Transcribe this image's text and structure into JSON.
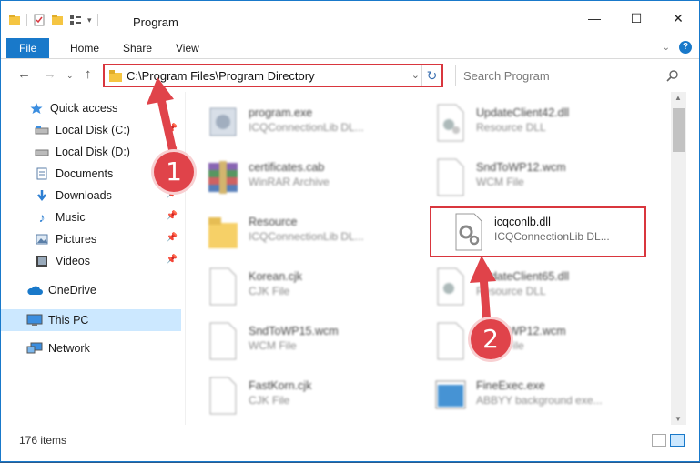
{
  "window": {
    "title": "Program",
    "controls": {
      "minimize": "—",
      "maximize": "☐",
      "close": "✕"
    }
  },
  "ribbon": {
    "tabs": [
      {
        "label": "File"
      },
      {
        "label": "Home"
      },
      {
        "label": "Share"
      },
      {
        "label": "View"
      }
    ],
    "help": "?"
  },
  "nav": {
    "address": "C:\\Program Files\\Program Directory",
    "search_placeholder": "Search Program"
  },
  "sidebar": {
    "items": [
      {
        "label": "Quick access",
        "icon": "star-icon"
      },
      {
        "label": "Local Disk (C:)",
        "icon": "drive-icon",
        "pinned": true
      },
      {
        "label": "Local Disk (D:)",
        "icon": "drive-icon",
        "pinned": true
      },
      {
        "label": "Documents",
        "icon": "document-icon",
        "pinned": true
      },
      {
        "label": "Downloads",
        "icon": "download-icon",
        "pinned": true
      },
      {
        "label": "Music",
        "icon": "music-icon",
        "pinned": true
      },
      {
        "label": "Pictures",
        "icon": "pictures-icon",
        "pinned": true
      },
      {
        "label": "Videos",
        "icon": "video-icon",
        "pinned": true
      },
      {
        "label": "OneDrive",
        "icon": "cloud-icon"
      },
      {
        "label": "This PC",
        "icon": "computer-icon",
        "selected": true
      },
      {
        "label": "Network",
        "icon": "network-icon"
      }
    ]
  },
  "files": [
    {
      "name": "program.exe",
      "type": "ICQConnectionLib DL...",
      "icon": "exe-icon"
    },
    {
      "name": "UpdateClient42.dll",
      "type": "Resource DLL",
      "icon": "dll-icon"
    },
    {
      "name": "certificates.cab",
      "type": "WinRAR Archive",
      "icon": "archive-icon"
    },
    {
      "name": "SndToWP12.wcm",
      "type": "WCM File",
      "icon": "file-icon"
    },
    {
      "name": "Resource",
      "type": "ICQConnectionLib DL...",
      "icon": "folder-icon"
    },
    {
      "name": "icqconlb.dll",
      "type": "ICQConnectionLib DL...",
      "icon": "dll-icon"
    },
    {
      "name": "Korean.cjk",
      "type": "CJK File",
      "icon": "file-icon"
    },
    {
      "name": "UpdateClient65.dll",
      "type": "Resource DLL",
      "icon": "dll-icon"
    },
    {
      "name": "SndToWP15.wcm",
      "type": "WCM File",
      "icon": "file-icon"
    },
    {
      "name": "SndToWP12.wcm",
      "type": "WCM File",
      "icon": "file-icon"
    },
    {
      "name": "FastKorn.cjk",
      "type": "CJK File",
      "icon": "file-icon"
    },
    {
      "name": "FineExec.exe",
      "type": "ABBYY background exe...",
      "icon": "app-icon"
    }
  ],
  "status": {
    "count": "176 items"
  },
  "annotations": {
    "step1": "1",
    "step2": "2",
    "color": "#e0434a"
  }
}
